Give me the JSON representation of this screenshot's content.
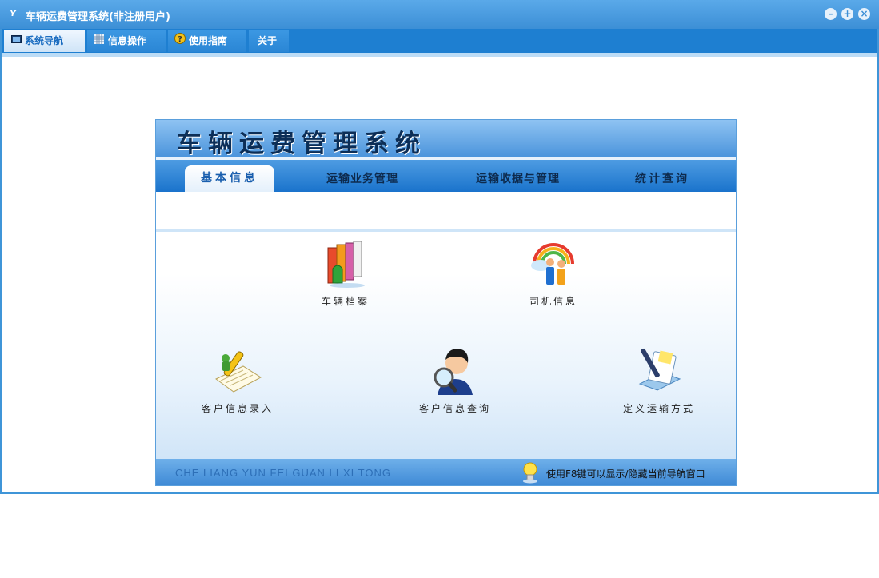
{
  "window": {
    "title": "车辆运费管理系统(非注册用户)",
    "app_icon_glyph": "Y",
    "controls": [
      "minimize-icon",
      "restore-icon",
      "close-icon"
    ]
  },
  "menu": [
    {
      "label": "系统导航",
      "icon": "monitor-icon",
      "active": true
    },
    {
      "label": "信息操作",
      "icon": "grid-icon",
      "active": false
    },
    {
      "label": "使用指南",
      "icon": "help-icon",
      "active": false
    },
    {
      "label": "关于",
      "icon": "",
      "active": false
    }
  ],
  "panel": {
    "title": "车辆运费管理系统",
    "tabs": [
      "基本信息",
      "运输业务管理",
      "运输收据与管理",
      "统计查询"
    ],
    "active_tab": "基本信息",
    "items": [
      {
        "label": "车辆档案",
        "icon": "books-icon"
      },
      {
        "label": "司机信息",
        "icon": "driver-rainbow-icon"
      },
      {
        "label": "客户信息录入",
        "icon": "pencil-notepad-icon"
      },
      {
        "label": "客户信息查询",
        "icon": "person-magnifier-icon"
      },
      {
        "label": "定义运输方式",
        "icon": "pen-document-icon"
      }
    ],
    "footer_text": "CHE LIANG YUN FEI GUAN LI XI TONG",
    "footer_hint": "使用F8键可以显示/隐藏当前导航窗口"
  },
  "colors": {
    "titlebar": "#3c8fd6",
    "menubar": "#1e7fd1",
    "panel_header": "#4c95dc"
  }
}
